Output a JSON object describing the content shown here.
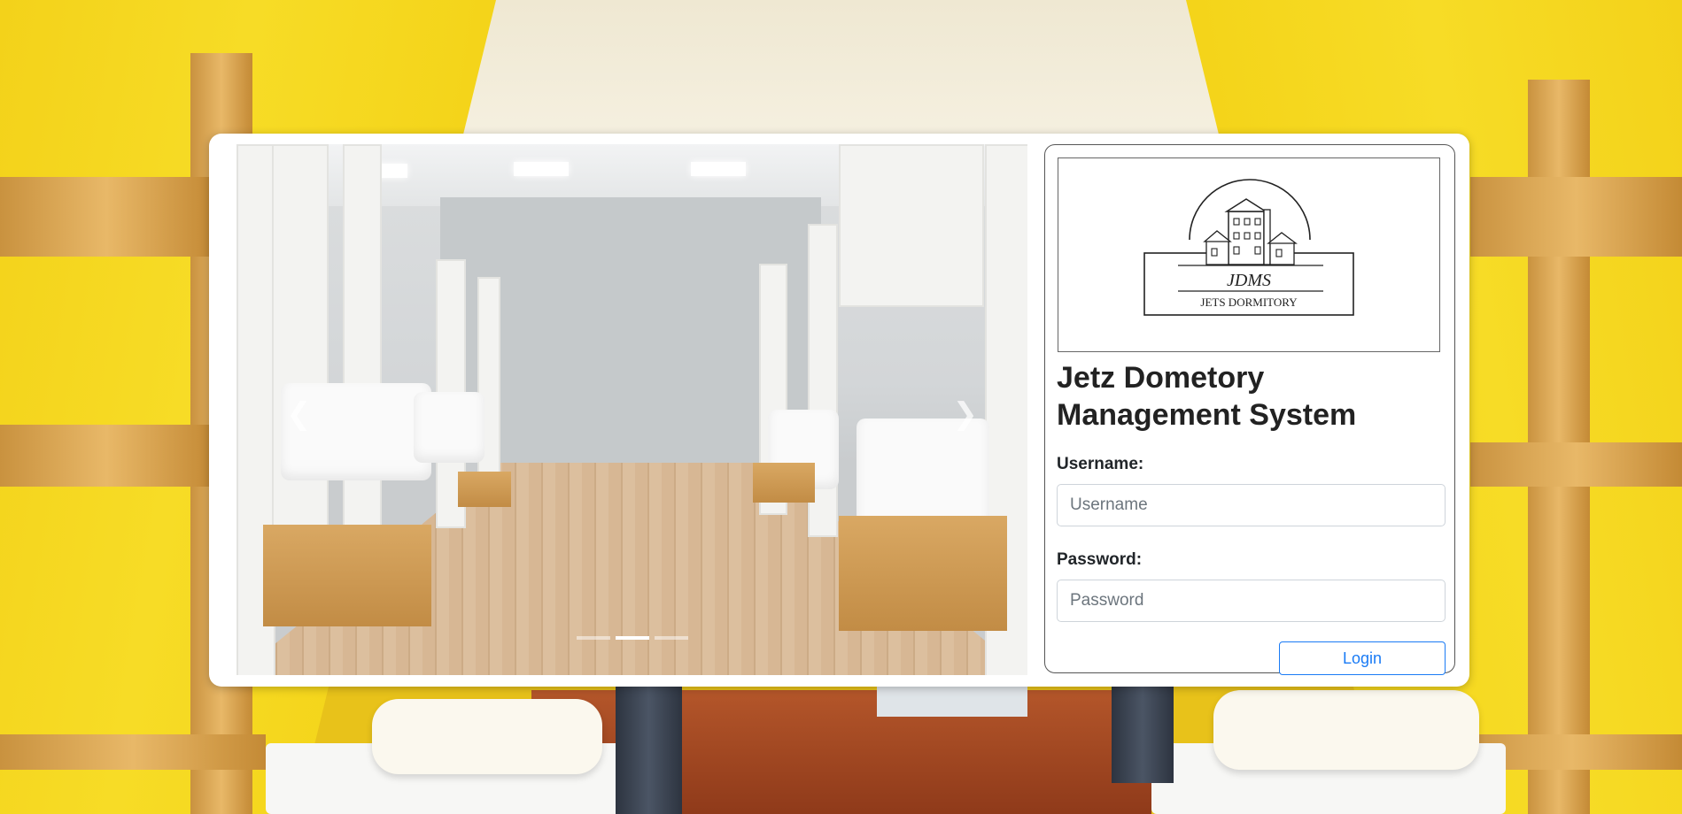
{
  "carousel": {
    "prev_icon": "chevron-left-icon",
    "next_icon": "chevron-right-icon",
    "prev_glyph": "❮",
    "next_glyph": "❯",
    "slide_count": 3,
    "active_slide": 2
  },
  "logo": {
    "acronym": "JDMS",
    "name": "JETS DORMITORY"
  },
  "login": {
    "title": "Jetz Dometory Management System",
    "username_label": "Username:",
    "username_placeholder": "Username",
    "username_value": "",
    "password_label": "Password:",
    "password_placeholder": "Password",
    "password_value": "",
    "login_button": "Login"
  },
  "colors": {
    "accent": "#1a7bf5",
    "wall": "#f3d21a"
  }
}
